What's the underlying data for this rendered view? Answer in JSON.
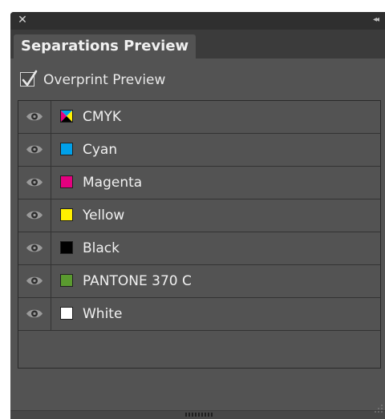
{
  "panel": {
    "title_bar": {
      "close_glyph": "✕",
      "collapse_glyph": "◂◂"
    },
    "tab": {
      "label": "Separations Preview"
    },
    "overprint": {
      "label": "Overprint Preview",
      "checked": true
    },
    "separations": [
      {
        "name": "CMYK",
        "swatch": "cmyk",
        "visible": true
      },
      {
        "name": "Cyan",
        "swatch": "#00a0e9",
        "visible": true
      },
      {
        "name": "Magenta",
        "swatch": "#e4007f",
        "visible": true
      },
      {
        "name": "Yellow",
        "swatch": "#fff000",
        "visible": true
      },
      {
        "name": "Black",
        "swatch": "#000000",
        "visible": true
      },
      {
        "name": "PANTONE 370 C",
        "swatch": "#5a9a2f",
        "visible": true
      },
      {
        "name": "White",
        "swatch": "#ffffff",
        "visible": true
      }
    ]
  },
  "colors": {
    "panel_bg": "#535353",
    "title_bar_bg": "#2f2f2f",
    "tab_strip_bg": "#3b3b3b",
    "text": "#f0f0f0"
  },
  "icons": {
    "close": "close-icon",
    "collapse": "double-chevron-left-icon",
    "visibility": "eye-icon",
    "checkbox": "checkmark-icon",
    "resize": "resize-grip-icon"
  }
}
